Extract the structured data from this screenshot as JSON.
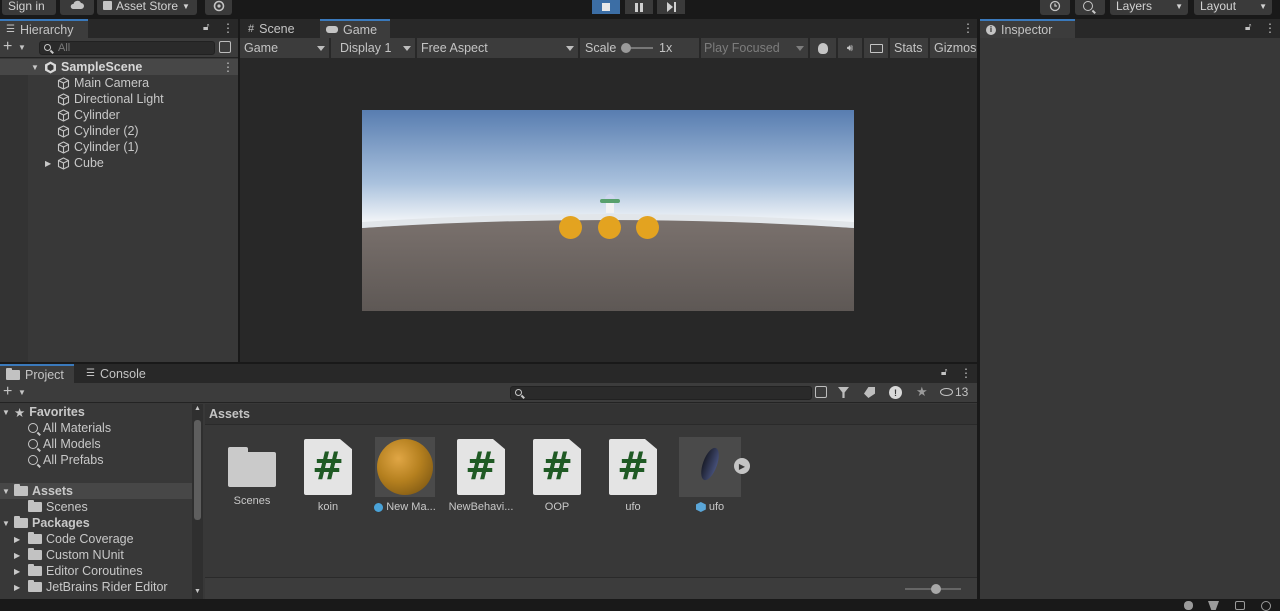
{
  "toolbar": {
    "sign_in": "Sign in",
    "asset_store": "Asset Store",
    "layers": "Layers",
    "layout": "Layout"
  },
  "hierarchy": {
    "tab_label": "Hierarchy",
    "search_placeholder": "All",
    "scene_name": "SampleScene",
    "items": [
      {
        "label": "Main Camera"
      },
      {
        "label": "Directional Light"
      },
      {
        "label": "Cylinder"
      },
      {
        "label": "Cylinder (2)"
      },
      {
        "label": "Cylinder (1)"
      },
      {
        "label": "Cube"
      }
    ]
  },
  "game": {
    "tabs": [
      "Scene",
      "Game"
    ],
    "view_mode": "Game",
    "display": "Display 1",
    "aspect": "Free Aspect",
    "scale_label": "Scale",
    "scale_value": "1x",
    "play_focused": "Play Focused",
    "stats": "Stats",
    "gizmos": "Gizmos"
  },
  "inspector": {
    "tab_label": "Inspector"
  },
  "project": {
    "tabs": [
      "Project",
      "Console"
    ],
    "hidden_count": "13",
    "breadcrumb": "Assets",
    "favorites": {
      "label": "Favorites",
      "items": [
        "All Materials",
        "All Models",
        "All Prefabs"
      ]
    },
    "assets_folder": {
      "label": "Assets",
      "children": [
        "Scenes"
      ]
    },
    "packages": {
      "label": "Packages",
      "children": [
        "Code Coverage",
        "Custom NUnit",
        "Editor Coroutines",
        "JetBrains Rider Editor"
      ]
    },
    "assets": [
      {
        "label": "Scenes",
        "type": "folder"
      },
      {
        "label": "koin",
        "type": "script"
      },
      {
        "label": "New Ma...",
        "type": "material"
      },
      {
        "label": "NewBehavi...",
        "type": "script"
      },
      {
        "label": "OOP",
        "type": "script"
      },
      {
        "label": "ufo",
        "type": "script"
      },
      {
        "label": "ufo",
        "type": "model"
      }
    ]
  },
  "colors": {
    "accent": "#3a79bb",
    "coin": "#e3a320",
    "script_hash": "#1f5a24"
  }
}
